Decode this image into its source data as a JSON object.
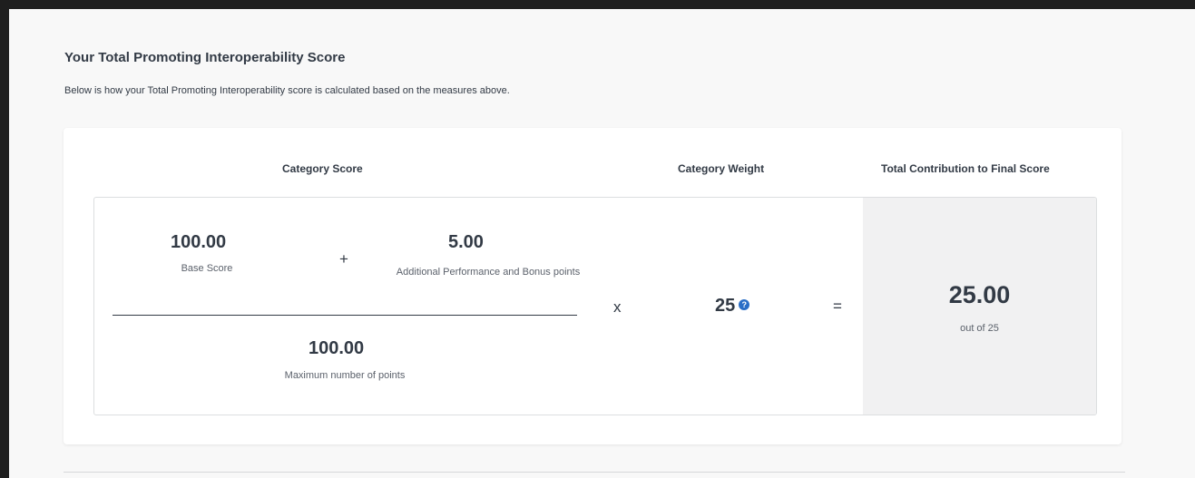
{
  "section": {
    "title": "Your Total Promoting Interoperability Score",
    "subtitle": "Below is how your Total Promoting Interoperability score is calculated based on the measures above."
  },
  "headers": {
    "category_score": "Category Score",
    "category_weight": "Category Weight",
    "total_contribution": "Total Contribution to Final Score"
  },
  "calculation": {
    "base_score_value": "100.00",
    "base_score_label": "Base Score",
    "plus_symbol": "+",
    "additional_value": "5.00",
    "additional_label": "Additional Performance and Bonus points",
    "max_points_value": "100.00",
    "max_points_label": "Maximum number of points",
    "multiply_symbol": "x",
    "weight_value": "25",
    "equals_symbol": "=",
    "total_value": "25.00",
    "total_label": "out of 25"
  },
  "icons": {
    "weight_help": "help-circle-icon"
  },
  "colors": {
    "help_icon": "#2a6ec6",
    "total_panel_bg": "#f1f1f2"
  }
}
